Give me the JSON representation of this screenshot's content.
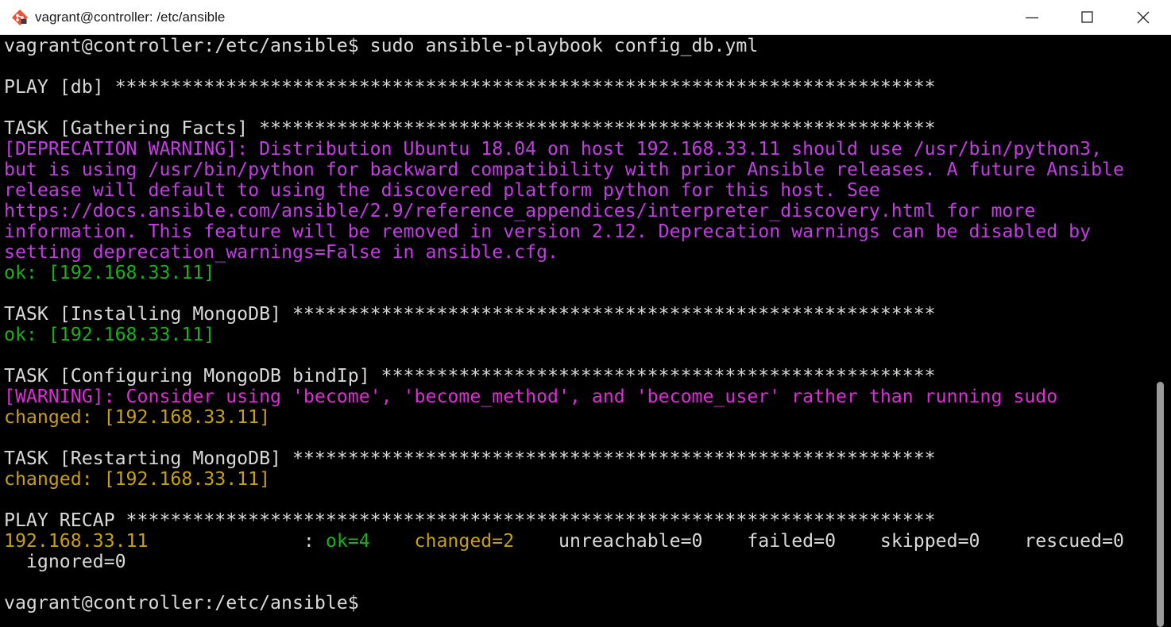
{
  "window": {
    "title": "vagrant@controller: /etc/ansible",
    "app_icon": "git-bash-icon",
    "controls": [
      "minimize-icon",
      "maximize-icon",
      "close-icon"
    ]
  },
  "colors": {
    "background": "#000000",
    "text": "#d9d9d9",
    "deprecation": "#c53be6",
    "warning": "#e02bd9",
    "ok": "#17b317",
    "changed": "#c8a00e"
  },
  "terminal": {
    "prompt_command": "vagrant@controller:/etc/ansible$ sudo ansible-playbook config_db.yml",
    "play_header": "PLAY [db] **************************************************************************",
    "task_gather": "TASK [Gathering Facts] *************************************************************",
    "deprecation": [
      "[DEPRECATION WARNING]: Distribution Ubuntu 18.04 on host 192.168.33.11 should use /usr/bin/python3,",
      "but is using /usr/bin/python for backward compatibility with prior Ansible releases. A future Ansible",
      "release will default to using the discovered platform python for this host. See",
      "https://docs.ansible.com/ansible/2.9/reference_appendices/interpreter_discovery.html for more",
      "information. This feature will be removed in version 2.12. Deprecation warnings can be disabled by",
      "setting deprecation_warnings=False in ansible.cfg."
    ],
    "ok_gather": "ok: [192.168.33.11]",
    "task_install": "TASK [Installing MongoDB] **********************************************************",
    "ok_install": "ok: [192.168.33.11]",
    "task_config": "TASK [Configuring MongoDB bindIp] **************************************************",
    "warning_become": "[WARNING]: Consider using 'become', 'become_method', and 'become_user' rather than running sudo",
    "changed_config": "changed: [192.168.33.11]",
    "task_restart": "TASK [Restarting MongoDB] **********************************************************",
    "changed_restart": "changed: [192.168.33.11]",
    "recap_header": "PLAY RECAP *************************************************************************",
    "recap": {
      "host": "192.168.33.11",
      "separator": "              : ",
      "ok": "ok=4",
      "gap1": "    ",
      "changed": "changed=2",
      "rest": "    unreachable=0    failed=0    skipped=0    rescued=0",
      "ignored": "  ignored=0"
    },
    "final_prompt": "vagrant@controller:/etc/ansible$"
  },
  "scrollbar": {
    "visible_fraction": 0.41,
    "position": "bottom"
  }
}
